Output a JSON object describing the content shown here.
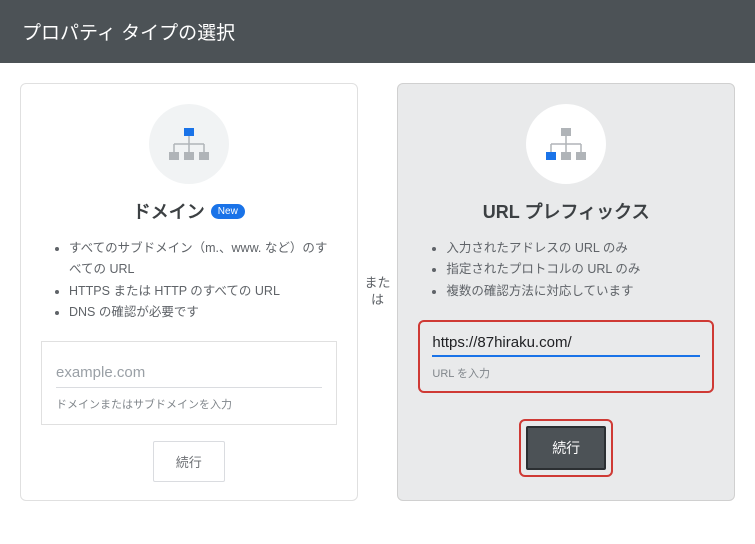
{
  "header": {
    "title": "プロパティ タイプの選択"
  },
  "divider": {
    "label": "または"
  },
  "domain_card": {
    "title": "ドメイン",
    "new_badge": "New",
    "features": [
      "すべてのサブドメイン（m.、www. など）のすべての URL",
      "HTTPS または HTTP のすべての URL",
      "DNS の確認が必要です"
    ],
    "input_placeholder": "example.com",
    "input_value": "",
    "input_helper": "ドメインまたはサブドメインを入力",
    "continue_label": "続行"
  },
  "url_card": {
    "title": "URL プレフィックス",
    "features": [
      "入力されたアドレスの URL のみ",
      "指定されたプロトコルの URL のみ",
      "複数の確認方法に対応しています"
    ],
    "input_value": "https://87hiraku.com/",
    "input_helper": "URL を入力",
    "continue_label": "続行"
  }
}
